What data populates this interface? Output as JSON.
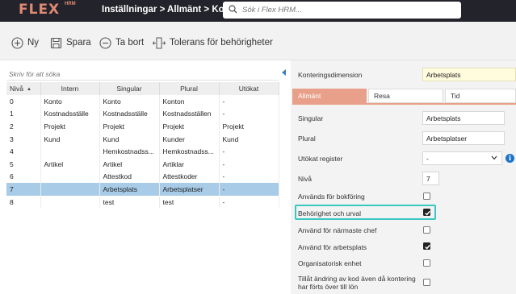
{
  "app": {
    "logo_text": "FLEX",
    "logo_sub": "HRM",
    "breadcrumb": "Inställningar > Allmänt > Kont...",
    "search_placeholder": "Sök i Flex HRM..."
  },
  "toolbar": {
    "new_label": "Ny",
    "save_label": "Spara",
    "delete_label": "Ta bort",
    "tolerance_label": "Tolerans för behörigheter"
  },
  "list": {
    "filter_placeholder": "Skriv för att söka",
    "columns": [
      "Nivå",
      "Intern",
      "Singular",
      "Plural",
      "Utökat"
    ],
    "rows": [
      {
        "niva": "0",
        "intern": "Konto",
        "singular": "Konto",
        "plural": "Konton",
        "utokat": "-"
      },
      {
        "niva": "1",
        "intern": "Kostnadsställe",
        "singular": "Kostnadsställe",
        "plural": "Kostnadsställen",
        "utokat": "-"
      },
      {
        "niva": "2",
        "intern": "Projekt",
        "singular": "Projekt",
        "plural": "Projekt",
        "utokat": "Projekt"
      },
      {
        "niva": "3",
        "intern": "Kund",
        "singular": "Kund",
        "plural": "Kunder",
        "utokat": "Kund"
      },
      {
        "niva": "4",
        "intern": "",
        "singular": "Hemkostnadss...",
        "plural": "Hemkostnadss...",
        "utokat": "-"
      },
      {
        "niva": "5",
        "intern": "Artikel",
        "singular": "Artikel",
        "plural": "Artiklar",
        "utokat": "-"
      },
      {
        "niva": "6",
        "intern": "",
        "singular": "Attestkod",
        "plural": "Attestkoder",
        "utokat": "-"
      },
      {
        "niva": "7",
        "intern": "",
        "singular": "Arbetsplats",
        "plural": "Arbetsplatser",
        "utokat": "-"
      },
      {
        "niva": "8",
        "intern": "",
        "singular": "test",
        "plural": "test",
        "utokat": "-"
      }
    ],
    "selected_index": 7
  },
  "detail": {
    "dimension_label": "Konteringsdimension",
    "dimension_value": "Arbetsplats",
    "tabs": [
      "Allmänt",
      "Resa",
      "Tid"
    ],
    "active_tab": "Allmänt",
    "singular_label": "Singular",
    "singular_value": "Arbetsplats",
    "plural_label": "Plural",
    "plural_value": "Arbetsplatser",
    "extended_label": "Utökat register",
    "extended_value": "-",
    "level_label": "Nivå",
    "level_value": "7",
    "checkboxes": [
      {
        "label": "Används för bokföring",
        "checked": false
      },
      {
        "label": "Behörighet och urval",
        "checked": true
      },
      {
        "label": "Använd för närmaste chef",
        "checked": false
      },
      {
        "label": "Använd för arbetsplats",
        "checked": true
      },
      {
        "label": "Organisatorisk enhet",
        "checked": false
      },
      {
        "label": "Tillåt ändring av kod även då kontering har förts över till lön",
        "checked": false
      }
    ]
  },
  "colors": {
    "topbar": "#23232b",
    "brand": "#e08a73",
    "tab_active": "#e8a08a",
    "selected_row": "#a8cbe8",
    "highlight": "#38c8c0",
    "info": "#1f73c7"
  }
}
